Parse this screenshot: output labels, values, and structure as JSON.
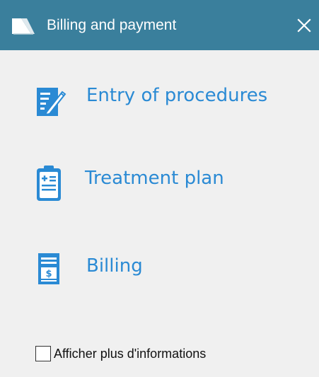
{
  "window": {
    "title": "Billing and payment",
    "title_icon": "book-icon",
    "close_icon": "close-icon",
    "titlebar_color": "#3a7f9c"
  },
  "menu": {
    "accent_color": "#2a8ad4",
    "items": [
      {
        "label": "Entry of procedures",
        "icon": "edit-document-icon"
      },
      {
        "label": "Treatment plan",
        "icon": "clipboard-plan-icon"
      },
      {
        "label": "Billing",
        "icon": "invoice-dollar-icon"
      }
    ]
  },
  "footer": {
    "checkbox_label": "Afficher plus d'informations",
    "checked": false
  }
}
